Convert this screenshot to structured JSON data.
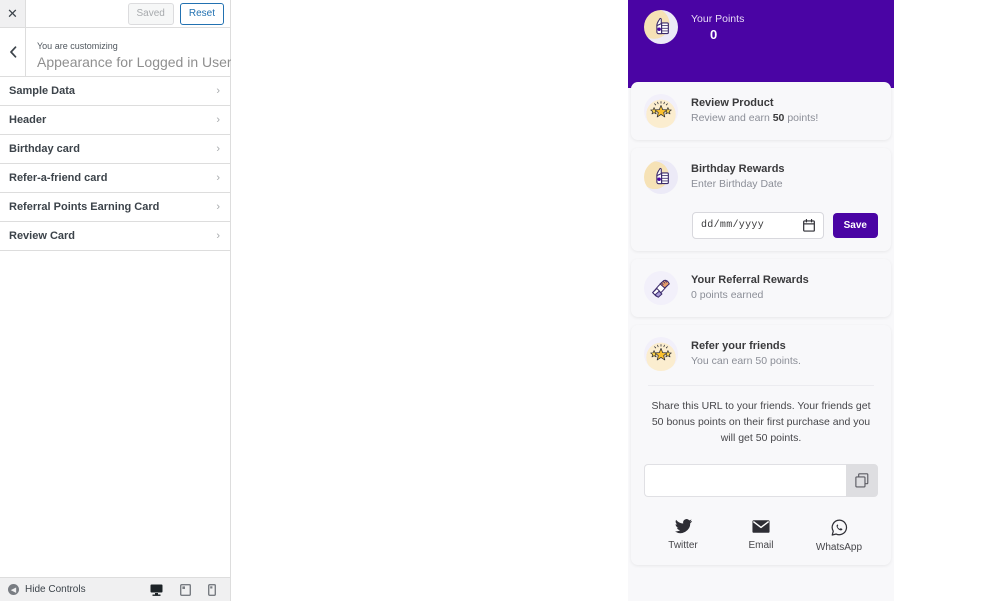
{
  "customizer": {
    "close_icon": "close-icon",
    "saved_label": "Saved",
    "reset_label": "Reset",
    "back_icon": "chevron-left-icon",
    "customizing_label": "You are customizing",
    "title": "Appearance for Logged in User",
    "items": [
      {
        "label": "Sample Data"
      },
      {
        "label": "Header"
      },
      {
        "label": "Birthday card"
      },
      {
        "label": "Refer-a-friend card"
      },
      {
        "label": "Referral Points Earning Card"
      },
      {
        "label": "Review Card"
      }
    ],
    "hide_controls_label": "Hide Controls",
    "devices": [
      {
        "name": "desktop-preview-button",
        "active": true
      },
      {
        "name": "tablet-preview-button",
        "active": false
      },
      {
        "name": "mobile-preview-button",
        "active": false
      }
    ]
  },
  "preview": {
    "hero": {
      "points_label": "Your Points",
      "points_value": "0",
      "icon": "thumbs-up-points-icon",
      "bg_color": "#4a04a4"
    },
    "cards": [
      {
        "id": "review-product",
        "icon": "stars-icon",
        "title": "Review Product",
        "sub_pre": "Review and earn ",
        "sub_strong": "50",
        "sub_post": " points!"
      },
      {
        "id": "birthday-rewards",
        "icon": "thumbs-up-icon",
        "title": "Birthday Rewards",
        "sub": "Enter Birthday Date",
        "date_value": "dd/mm/yyyy",
        "date_icon": "calendar-icon",
        "save_label": "Save",
        "save_color": "#4a04a4"
      },
      {
        "id": "referral-rewards",
        "icon": "handshake-icon",
        "title": "Your Referral Rewards",
        "sub": "0 points earned"
      },
      {
        "id": "refer-friends",
        "icon": "stars-icon",
        "title": "Refer your friends",
        "sub": "You can earn 50 points.",
        "share_text": "Share this URL to your friends. Your friends get 50 bonus points on their first purchase and you will get 50 points.",
        "url_value": "",
        "copy_icon": "copy-icon",
        "socials": [
          {
            "icon": "twitter-icon",
            "label": "Twitter"
          },
          {
            "icon": "email-icon",
            "label": "Email"
          },
          {
            "icon": "whatsapp-icon",
            "label": "WhatsApp"
          }
        ]
      }
    ]
  }
}
